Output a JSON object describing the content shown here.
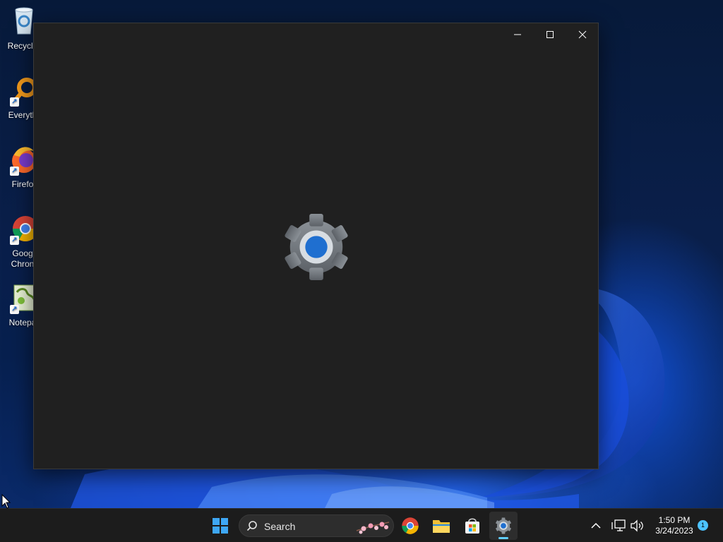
{
  "desktop": {
    "icons": [
      {
        "label": "Recycle",
        "icon": "recycle-bin-icon"
      },
      {
        "label": "Everyth",
        "icon": "everything-search-icon"
      },
      {
        "label": "Firefo",
        "icon": "firefox-icon"
      },
      {
        "label": "Goog\nChron",
        "icon": "chrome-icon"
      },
      {
        "label": "Notepa",
        "icon": "notepad-plus-plus-icon"
      }
    ]
  },
  "window": {
    "splash_icon": "settings-gear-icon",
    "controls": {
      "minimize": "minimize-icon",
      "maximize": "maximize-icon",
      "close": "close-icon"
    }
  },
  "taskbar": {
    "search_label": "Search",
    "apps": [
      "start-icon",
      "chrome-icon",
      "file-explorer-icon",
      "microsoft-store-icon",
      "settings-icon"
    ],
    "active_app": "settings",
    "clock_time": "1:50 PM",
    "clock_date": "3/24/2023",
    "notification_count": "1"
  },
  "colors": {
    "window_bg": "#202020",
    "taskbar_bg": "#1c1c1c",
    "accent": "#60cdff",
    "gear_blue": "#1f6fd0"
  }
}
